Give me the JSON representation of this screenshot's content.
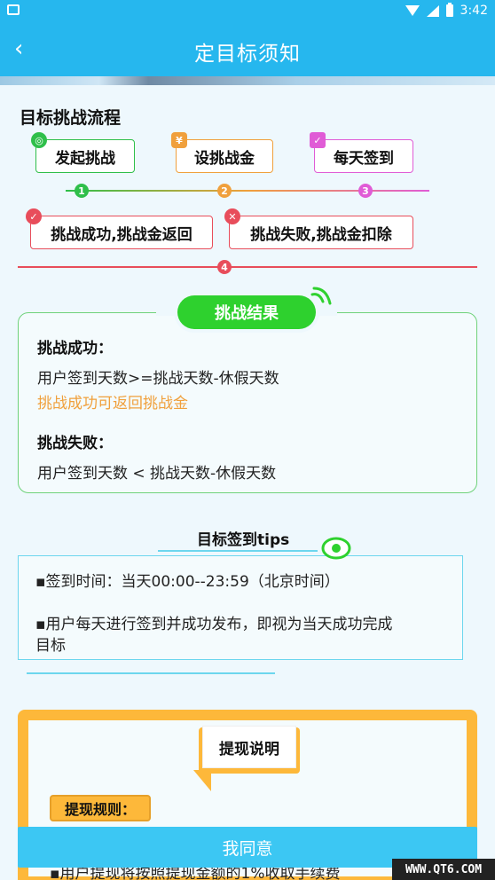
{
  "status_bar": {
    "time": "3:42"
  },
  "app_bar": {
    "back_icon": "chevron-left-icon",
    "back_glyph": "‹",
    "title": "定目标须知"
  },
  "flow": {
    "title": "目标挑战流程",
    "steps": [
      {
        "label": "发起挑战",
        "icon": "target-icon",
        "color": "#2fbf4a"
      },
      {
        "label": "设挑战金",
        "icon": "money-bag-icon",
        "color": "#f0a03c"
      },
      {
        "label": "每天签到",
        "icon": "calendar-icon",
        "color": "#e05cd6"
      }
    ],
    "step_numbers": [
      "1",
      "2",
      "3"
    ],
    "outcomes": [
      {
        "label": "挑战成功,挑战金返回",
        "icon": "check-icon",
        "color": "#e84d5b"
      },
      {
        "label": "挑战失败,挑战金扣除",
        "icon": "cross-icon",
        "color": "#e84d5b"
      }
    ],
    "outcome_number": "4"
  },
  "result": {
    "title": "挑战结果",
    "success_heading": "挑战成功：",
    "success_rule": "用户签到天数>=挑战天数-休假天数",
    "success_note": "挑战成功可返回挑战金",
    "fail_heading": "挑战失败：",
    "fail_rule": "用户签到天数 < 挑战天数-休假天数"
  },
  "tips": {
    "title": "目标签到tips",
    "line1": "▪签到时间：当天00:00--23:59（北京时间）",
    "line2a": "▪用户每天进行签到并成功发布，即视为当天成功完成",
    "line2b": "目标"
  },
  "withdraw": {
    "title": "提现说明",
    "rules_label": "提现规则：",
    "partial_text": "▪用户提现将按照提现金额的1%收取手续费"
  },
  "agree_button": "我同意",
  "watermark": "WWW.QT6.COM",
  "colors": {
    "primary": "#26b7ee",
    "green": "#2ed12e",
    "orange": "#fdb83a",
    "red": "#e84d5b"
  }
}
